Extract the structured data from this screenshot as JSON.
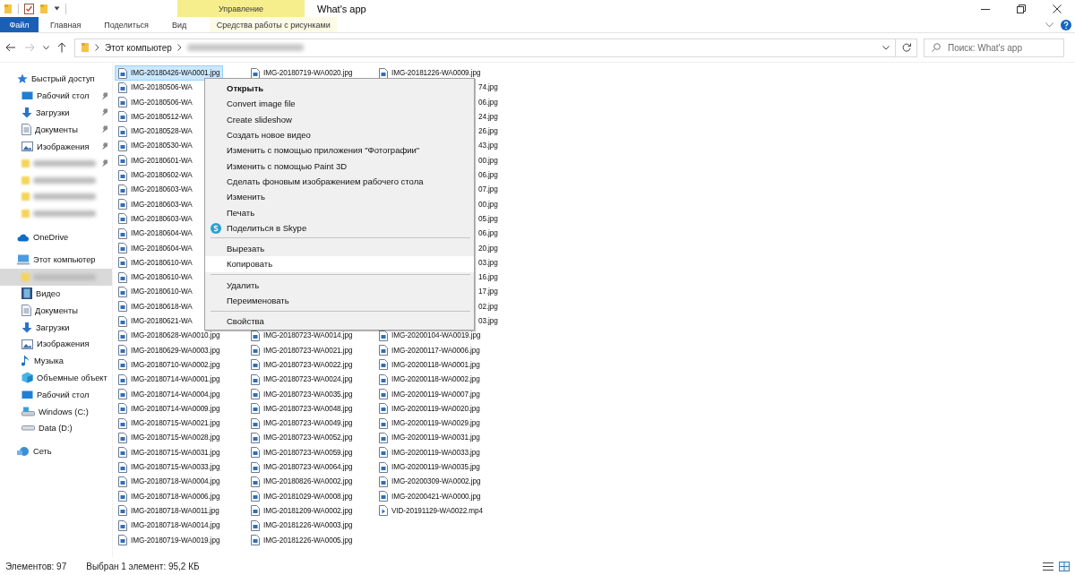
{
  "window": {
    "title": "What's app"
  },
  "ribbon": {
    "context_group": "Управление",
    "tabs": [
      {
        "label": "Файл",
        "kind": "file",
        "selected": false
      },
      {
        "label": "Главная",
        "kind": "tab",
        "selected": false
      },
      {
        "label": "Поделиться",
        "kind": "tab",
        "selected": false
      },
      {
        "label": "Вид",
        "kind": "tab",
        "selected": false
      },
      {
        "label": "Средства работы с рисунками",
        "kind": "context",
        "selected": false
      }
    ]
  },
  "address": {
    "segments": [
      {
        "kind": "text",
        "label": "Этот компьютер"
      },
      {
        "kind": "redacted"
      }
    ]
  },
  "search": {
    "placeholder": "Поиск: What's app"
  },
  "navigation": [
    {
      "label": "Быстрый доступ",
      "kind": "star",
      "children": [
        {
          "label": "Рабочий стол",
          "kind": "desktop",
          "pinned": true,
          "selected": false
        },
        {
          "label": "Загрузки",
          "kind": "download",
          "pinned": true,
          "selected": false
        },
        {
          "label": "Документы",
          "kind": "document",
          "pinned": true,
          "selected": false
        },
        {
          "label": "Изображения",
          "kind": "pictures",
          "pinned": true,
          "selected": false
        },
        {
          "kind": "redacted",
          "pinned": true,
          "selected": false
        },
        {
          "kind": "redacted",
          "pinned": false,
          "selected": false
        },
        {
          "kind": "redacted",
          "pinned": false,
          "selected": false
        },
        {
          "kind": "redacted",
          "pinned": false,
          "selected": false
        }
      ]
    },
    {
      "label": "OneDrive",
      "kind": "cloud"
    },
    {
      "label": "Этот компьютер",
      "kind": "computer",
      "children": [
        {
          "kind": "redacted",
          "pinned": false,
          "selected": true
        },
        {
          "label": "Видео",
          "kind": "video",
          "pinned": false,
          "selected": false
        },
        {
          "label": "Документы",
          "kind": "document",
          "pinned": false,
          "selected": false
        },
        {
          "label": "Загрузки",
          "kind": "download",
          "pinned": false,
          "selected": false
        },
        {
          "label": "Изображения",
          "kind": "pictures",
          "pinned": false,
          "selected": false
        },
        {
          "label": "Музыка",
          "kind": "music",
          "pinned": false,
          "selected": false
        },
        {
          "label": "Объемные объект",
          "kind": "cube",
          "pinned": false,
          "selected": false
        },
        {
          "label": "Рабочий стол",
          "kind": "desktop",
          "pinned": false,
          "selected": false
        },
        {
          "label": "Windows (C:)",
          "kind": "drive",
          "pinned": false,
          "selected": false
        },
        {
          "label": "Data (D:)",
          "kind": "disk",
          "pinned": false,
          "selected": false
        }
      ]
    },
    {
      "label": "Сеть",
      "kind": "network"
    }
  ],
  "files": [
    {
      "column_1": {
        "name": "IMG-20180426-WA0001.jpg",
        "kind": "image",
        "selected": true
      },
      "column_2": {
        "name": "IMG-20180719-WA0020.jpg",
        "kind": "image",
        "selected": false
      },
      "column_3": {
        "name": "IMG-20181226-WA0009.jpg",
        "kind": "image",
        "selected": false
      }
    },
    {
      "column_1": {
        "name": "IMG-20180506-WA",
        "kind": "image",
        "selected": false
      },
      "column_3": {
        "name": "74.jpg",
        "kind": "partial",
        "selected": false
      }
    },
    {
      "column_1": {
        "name": "IMG-20180506-WA",
        "kind": "image",
        "selected": false
      },
      "column_3": {
        "name": "06.jpg",
        "kind": "partial",
        "selected": false
      }
    },
    {
      "column_1": {
        "name": "IMG-20180512-WA",
        "kind": "image",
        "selected": false
      },
      "column_3": {
        "name": "24.jpg",
        "kind": "partial",
        "selected": false
      }
    },
    {
      "column_1": {
        "name": "IMG-20180528-WA",
        "kind": "image",
        "selected": false
      },
      "column_3": {
        "name": "26.jpg",
        "kind": "partial",
        "selected": false
      }
    },
    {
      "column_1": {
        "name": "IMG-20180530-WA",
        "kind": "image",
        "selected": false
      },
      "column_3": {
        "name": "43.jpg",
        "kind": "partial",
        "selected": false
      }
    },
    {
      "column_1": {
        "name": "IMG-20180601-WA",
        "kind": "image",
        "selected": false
      },
      "column_3": {
        "name": "00.jpg",
        "kind": "partial",
        "selected": false
      }
    },
    {
      "column_1": {
        "name": "IMG-20180602-WA",
        "kind": "image",
        "selected": false
      },
      "column_3": {
        "name": "06.jpg",
        "kind": "partial",
        "selected": false
      }
    },
    {
      "column_1": {
        "name": "IMG-20180603-WA",
        "kind": "image",
        "selected": false
      },
      "column_3": {
        "name": "07.jpg",
        "kind": "partial",
        "selected": false
      }
    },
    {
      "column_1": {
        "name": "IMG-20180603-WA",
        "kind": "image",
        "selected": false
      },
      "column_3": {
        "name": "00.jpg",
        "kind": "partial",
        "selected": false
      }
    },
    {
      "column_1": {
        "name": "IMG-20180603-WA",
        "kind": "image",
        "selected": false
      },
      "column_3": {
        "name": "05.jpg",
        "kind": "partial",
        "selected": false
      }
    },
    {
      "column_1": {
        "name": "IMG-20180604-WA",
        "kind": "image",
        "selected": false
      },
      "column_3": {
        "name": "06.jpg",
        "kind": "partial",
        "selected": false
      }
    },
    {
      "column_1": {
        "name": "IMG-20180604-WA",
        "kind": "image",
        "selected": false
      },
      "column_3": {
        "name": "20.jpg",
        "kind": "partial",
        "selected": false
      }
    },
    {
      "column_1": {
        "name": "IMG-20180610-WA",
        "kind": "image",
        "selected": false
      },
      "column_3": {
        "name": "03.jpg",
        "kind": "partial",
        "selected": false
      }
    },
    {
      "column_1": {
        "name": "IMG-20180610-WA",
        "kind": "image",
        "selected": false
      },
      "column_3": {
        "name": "16.jpg",
        "kind": "partial",
        "selected": false
      }
    },
    {
      "column_1": {
        "name": "IMG-20180610-WA",
        "kind": "image",
        "selected": false
      },
      "column_3": {
        "name": "17.jpg",
        "kind": "partial",
        "selected": false
      }
    },
    {
      "column_1": {
        "name": "IMG-20180618-WA",
        "kind": "image",
        "selected": false
      },
      "column_3": {
        "name": "02.jpg",
        "kind": "partial",
        "selected": false
      }
    },
    {
      "column_1": {
        "name": "IMG-20180621-WA",
        "kind": "image",
        "selected": false
      },
      "column_3": {
        "name": "03.jpg",
        "kind": "partial",
        "selected": false
      }
    },
    {
      "column_1": {
        "name": "IMG-20180628-WA0010.jpg",
        "kind": "image",
        "selected": false
      },
      "column_2": {
        "name": "IMG-20180723-WA0014.jpg",
        "kind": "image",
        "selected": false
      },
      "column_3": {
        "name": "IMG-20200104-WA0019.jpg",
        "kind": "image",
        "selected": false
      }
    },
    {
      "column_1": {
        "name": "IMG-20180629-WA0003.jpg",
        "kind": "image",
        "selected": false
      },
      "column_2": {
        "name": "IMG-20180723-WA0021.jpg",
        "kind": "image",
        "selected": false
      },
      "column_3": {
        "name": "IMG-20200117-WA0006.jpg",
        "kind": "image",
        "selected": false
      }
    },
    {
      "column_1": {
        "name": "IMG-20180710-WA0002.jpg",
        "kind": "image",
        "selected": false
      },
      "column_2": {
        "name": "IMG-20180723-WA0022.jpg",
        "kind": "image",
        "selected": false
      },
      "column_3": {
        "name": "IMG-20200118-WA0001.jpg",
        "kind": "image",
        "selected": false
      }
    },
    {
      "column_1": {
        "name": "IMG-20180714-WA0001.jpg",
        "kind": "image",
        "selected": false
      },
      "column_2": {
        "name": "IMG-20180723-WA0024.jpg",
        "kind": "image",
        "selected": false
      },
      "column_3": {
        "name": "IMG-20200118-WA0002.jpg",
        "kind": "image",
        "selected": false
      }
    },
    {
      "column_1": {
        "name": "IMG-20180714-WA0004.jpg",
        "kind": "image",
        "selected": false
      },
      "column_2": {
        "name": "IMG-20180723-WA0035.jpg",
        "kind": "image",
        "selected": false
      },
      "column_3": {
        "name": "IMG-20200119-WA0007.jpg",
        "kind": "image",
        "selected": false
      }
    },
    {
      "column_1": {
        "name": "IMG-20180714-WA0009.jpg",
        "kind": "image",
        "selected": false
      },
      "column_2": {
        "name": "IMG-20180723-WA0048.jpg",
        "kind": "image",
        "selected": false
      },
      "column_3": {
        "name": "IMG-20200119-WA0020.jpg",
        "kind": "image",
        "selected": false
      }
    },
    {
      "column_1": {
        "name": "IMG-20180715-WA0021.jpg",
        "kind": "image",
        "selected": false
      },
      "column_2": {
        "name": "IMG-20180723-WA0049.jpg",
        "kind": "image",
        "selected": false
      },
      "column_3": {
        "name": "IMG-20200119-WA0029.jpg",
        "kind": "image",
        "selected": false
      }
    },
    {
      "column_1": {
        "name": "IMG-20180715-WA0028.jpg",
        "kind": "image",
        "selected": false
      },
      "column_2": {
        "name": "IMG-20180723-WA0052.jpg",
        "kind": "image",
        "selected": false
      },
      "column_3": {
        "name": "IMG-20200119-WA0031.jpg",
        "kind": "image",
        "selected": false
      }
    },
    {
      "column_1": {
        "name": "IMG-20180715-WA0031.jpg",
        "kind": "image",
        "selected": false
      },
      "column_2": {
        "name": "IMG-20180723-WA0059.jpg",
        "kind": "image",
        "selected": false
      },
      "column_3": {
        "name": "IMG-20200119-WA0033.jpg",
        "kind": "image",
        "selected": false
      }
    },
    {
      "column_1": {
        "name": "IMG-20180715-WA0033.jpg",
        "kind": "image",
        "selected": false
      },
      "column_2": {
        "name": "IMG-20180723-WA0064.jpg",
        "kind": "image",
        "selected": false
      },
      "column_3": {
        "name": "IMG-20200119-WA0035.jpg",
        "kind": "image",
        "selected": false
      }
    },
    {
      "column_1": {
        "name": "IMG-20180718-WA0004.jpg",
        "kind": "image",
        "selected": false
      },
      "column_2": {
        "name": "IMG-20180826-WA0002.jpg",
        "kind": "image",
        "selected": false
      },
      "column_3": {
        "name": "IMG-20200309-WA0002.jpg",
        "kind": "image",
        "selected": false
      }
    },
    {
      "column_1": {
        "name": "IMG-20180718-WA0006.jpg",
        "kind": "image",
        "selected": false
      },
      "column_2": {
        "name": "IMG-20181029-WA0008.jpg",
        "kind": "image",
        "selected": false
      },
      "column_3": {
        "name": "IMG-20200421-WA0000.jpg",
        "kind": "image",
        "selected": false
      }
    },
    {
      "column_1": {
        "name": "IMG-20180718-WA0011.jpg",
        "kind": "image",
        "selected": false
      },
      "column_2": {
        "name": "IMG-20181209-WA0002.jpg",
        "kind": "image",
        "selected": false
      },
      "column_3": {
        "name": "VID-20191129-WA0022.mp4",
        "kind": "video",
        "selected": false
      }
    },
    {
      "column_1": {
        "name": "IMG-20180718-WA0014.jpg",
        "kind": "image",
        "selected": false
      },
      "column_2": {
        "name": "IMG-20181226-WA0003.jpg",
        "kind": "image",
        "selected": false
      }
    },
    {
      "column_1": {
        "name": "IMG-20180719-WA0019.jpg",
        "kind": "image",
        "selected": false
      },
      "column_2": {
        "name": "IMG-20181226-WA0005.jpg",
        "kind": "image",
        "selected": false
      }
    }
  ],
  "context_menu": [
    {
      "kind": "item",
      "label": "Открыть",
      "default": true,
      "selected": false
    },
    {
      "kind": "item",
      "label": "Convert image file",
      "default": false,
      "selected": false
    },
    {
      "kind": "item",
      "label": "Create slideshow",
      "default": false,
      "selected": false
    },
    {
      "kind": "item",
      "label": "Создать новое видео",
      "default": false,
      "selected": false
    },
    {
      "kind": "item",
      "label": "Изменить с помощью приложения \"Фотографии\"",
      "default": false,
      "selected": false
    },
    {
      "kind": "item",
      "label": "Изменить с помощью Paint 3D",
      "default": false,
      "selected": false
    },
    {
      "kind": "item",
      "label": "Сделать фоновым изображением рабочего стола",
      "default": false,
      "selected": false
    },
    {
      "kind": "item",
      "label": "Изменить",
      "default": false,
      "selected": false
    },
    {
      "kind": "item",
      "label": "Печать",
      "default": false,
      "selected": false
    },
    {
      "kind": "share",
      "label": "Поделиться в Skype",
      "default": false,
      "selected": false
    },
    {
      "kind": "separator"
    },
    {
      "kind": "item",
      "label": "Вырезать",
      "default": false,
      "selected": false
    },
    {
      "kind": "item",
      "label": "Копировать",
      "default": false,
      "selected": true
    },
    {
      "kind": "separator"
    },
    {
      "kind": "item",
      "label": "Удалить",
      "default": false,
      "selected": false
    },
    {
      "kind": "item",
      "label": "Переименовать",
      "default": false,
      "selected": false
    },
    {
      "kind": "separator"
    },
    {
      "kind": "item",
      "label": "Свойства",
      "default": false,
      "selected": false
    }
  ],
  "status_bar": {
    "item_count": "Элементов: 97",
    "selection": "Выбран 1 элемент: 95,2 КБ"
  }
}
